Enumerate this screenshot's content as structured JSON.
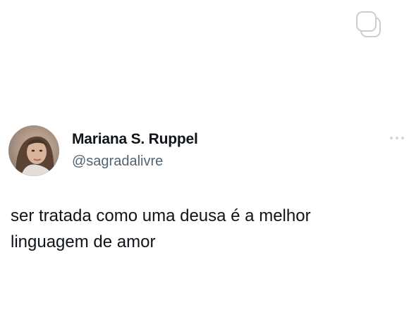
{
  "icons": {
    "copy": "copy-icon",
    "more": "more-icon"
  },
  "author": {
    "name": "Mariana S. Ruppel",
    "handle": "@sagradalivre"
  },
  "tweet": {
    "lines": [
      "ser tratada como uma deusa é a melhor",
      "linguagem de amor"
    ]
  }
}
